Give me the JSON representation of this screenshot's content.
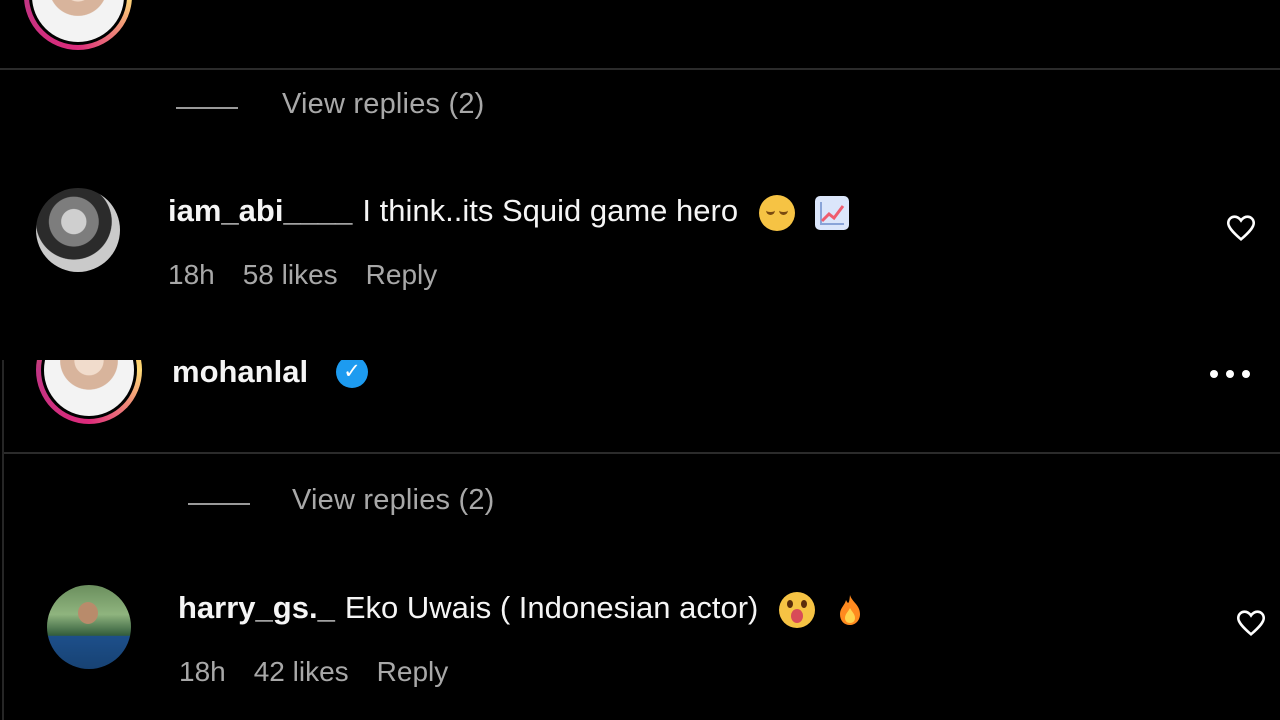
{
  "top_section": {
    "view_replies_label": "View replies (2)",
    "comment": {
      "username": "iam_abi____",
      "text": "I think..its Squid game hero",
      "emojis": [
        "relieved-face-icon",
        "chart-increasing-icon"
      ],
      "time": "18h",
      "likes": "58 likes",
      "reply_label": "Reply"
    }
  },
  "bottom_section": {
    "post": {
      "username": "mohanlal",
      "verified_icon": "verified-badge-icon",
      "more_icon": "more-options-icon"
    },
    "view_replies_label": "View replies (2)",
    "comment": {
      "username": "harry_gs._",
      "text": "Eko Uwais ( Indonesian actor)",
      "emojis": [
        "astonished-face-icon",
        "fire-icon"
      ],
      "time": "18h",
      "likes": "42 likes",
      "reply_label": "Reply"
    }
  },
  "colors": {
    "background": "#000000",
    "text_primary": "#f5f5f5",
    "text_secondary": "#a8a8a8",
    "verified_blue": "#1d9bf0"
  }
}
